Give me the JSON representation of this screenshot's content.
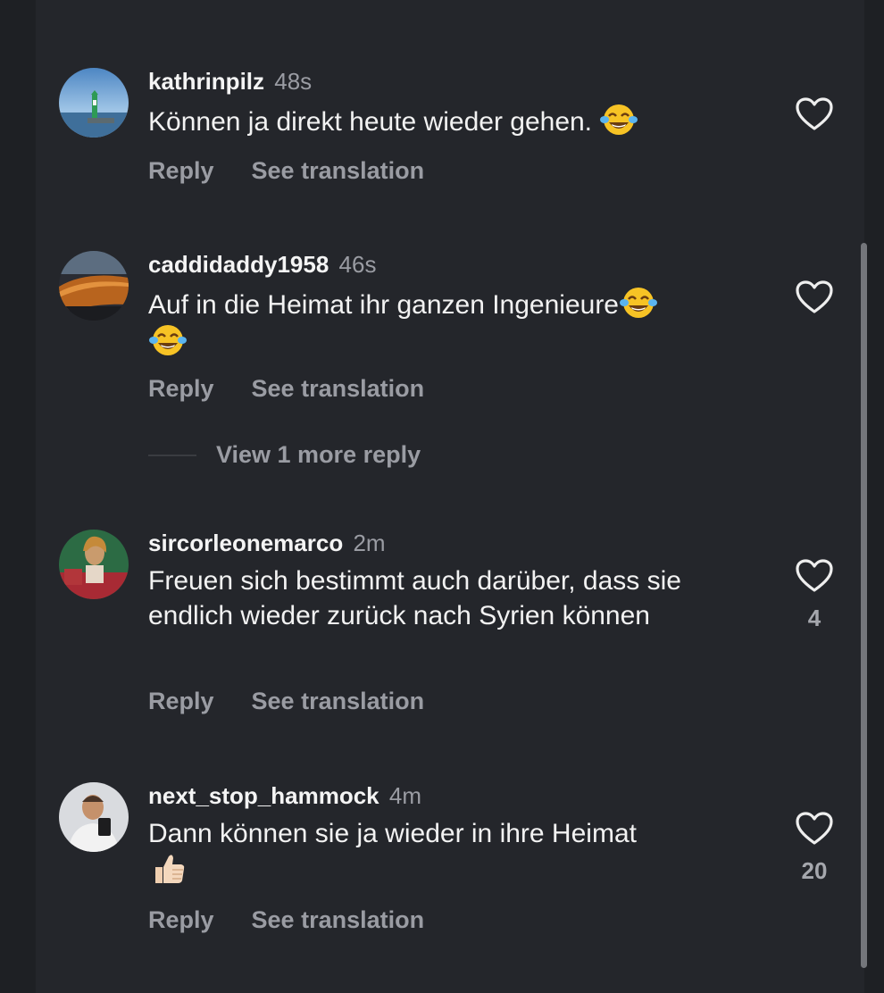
{
  "comments": [
    {
      "username": "kathrinpilz",
      "time": "48s",
      "text": "Können ja direkt heute wieder gehen.",
      "emoji": "face-with-tears-of-joy",
      "reply_label": "Reply",
      "translate_label": "See translation",
      "likes": ""
    },
    {
      "username": "caddidaddy1958",
      "time": "46s",
      "text": "Auf in die Heimat ihr ganzen Ingenieure",
      "emoji": "face-with-tears-of-joy",
      "reply_label": "Reply",
      "translate_label": "See translation",
      "likes": "",
      "view_more": "View 1 more reply"
    },
    {
      "username": "sircorleonemarco",
      "time": "2m",
      "text": "Freuen sich bestimmt auch darüber, dass sie endlich wieder zurück nach Syrien können",
      "reply_label": "Reply",
      "translate_label": "See translation",
      "likes": "4"
    },
    {
      "username": "next_stop_hammock",
      "time": "4m",
      "text": "Dann können sie ja wieder in ihre Heimat",
      "emoji": "thumbs-up",
      "reply_label": "Reply",
      "translate_label": "See translation",
      "likes": "20"
    }
  ],
  "colors": {
    "background": "#24262b",
    "text": "#f2f2f2",
    "muted": "#9a9ca3",
    "scrollbar": "#74767b"
  }
}
